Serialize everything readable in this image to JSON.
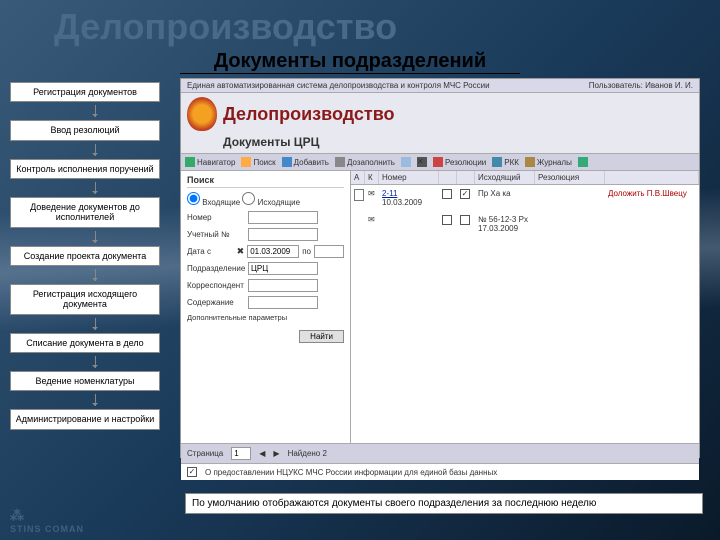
{
  "main_title": "Делопроизводство",
  "subtitle": "Документы подразделений",
  "steps": [
    "Регистрация документов",
    "Ввод резолюций",
    "Контроль исполнения поручений",
    "Доведение документов до исполнителей",
    "Создание проекта документа",
    "Регистрация исходящего документа",
    "Списание документа в дело",
    "Ведение номенклатуры",
    "Администрирование и настройки"
  ],
  "ss": {
    "header_left": "Единая автоматизированная система делопроизводства и контроля МЧС России",
    "header_right": "Пользователь: Иванов И. И.",
    "title": "Делопроизводство",
    "subtitle": "Документы ЦРЦ",
    "toolbar": [
      "Навигатор",
      "Поиск",
      "Добавить",
      "Дозаполнить",
      "",
      "",
      "Резолюции",
      "РКК",
      "Журналы",
      ""
    ]
  },
  "search": {
    "title": "Поиск",
    "radio1": "Входящие",
    "radio2": "Исходящие",
    "f_number": "Номер",
    "f_uch": "Учетный №",
    "f_date": "Дата с",
    "date_from": "01.03.2009",
    "date_to": "по",
    "f_dept": "Подразделение",
    "dept_val": "ЦРЦ",
    "f_corr": "Корреспондент",
    "f_content": "Содержание",
    "f_extra": "Дополнительные параметры",
    "btn": "Найти"
  },
  "list": {
    "cols": [
      "А",
      "К",
      "Номер",
      "",
      "",
      "Исходящий",
      "Резолюция",
      ""
    ],
    "rows": [
      {
        "num": "2-11",
        "date": "10.03.2009",
        "out_no": "Пр Ха ка",
        "res": "",
        "report": "Доложить П.В.Швецу"
      },
      {
        "num": "",
        "date": "",
        "out_no": "№ 56-12-3 Рх 17.03.2009",
        "res": "",
        "report": ""
      }
    ]
  },
  "footer": {
    "pager_label": "Страница",
    "pager_val": "1",
    "total": "Найдено 2",
    "note": "О предоставлении НЦУКС МЧС России информации для единой базы данных"
  },
  "caption": "По умолчанию отображаются документы своего подразделения за последнюю неделю",
  "brand": "STINS COMAN"
}
